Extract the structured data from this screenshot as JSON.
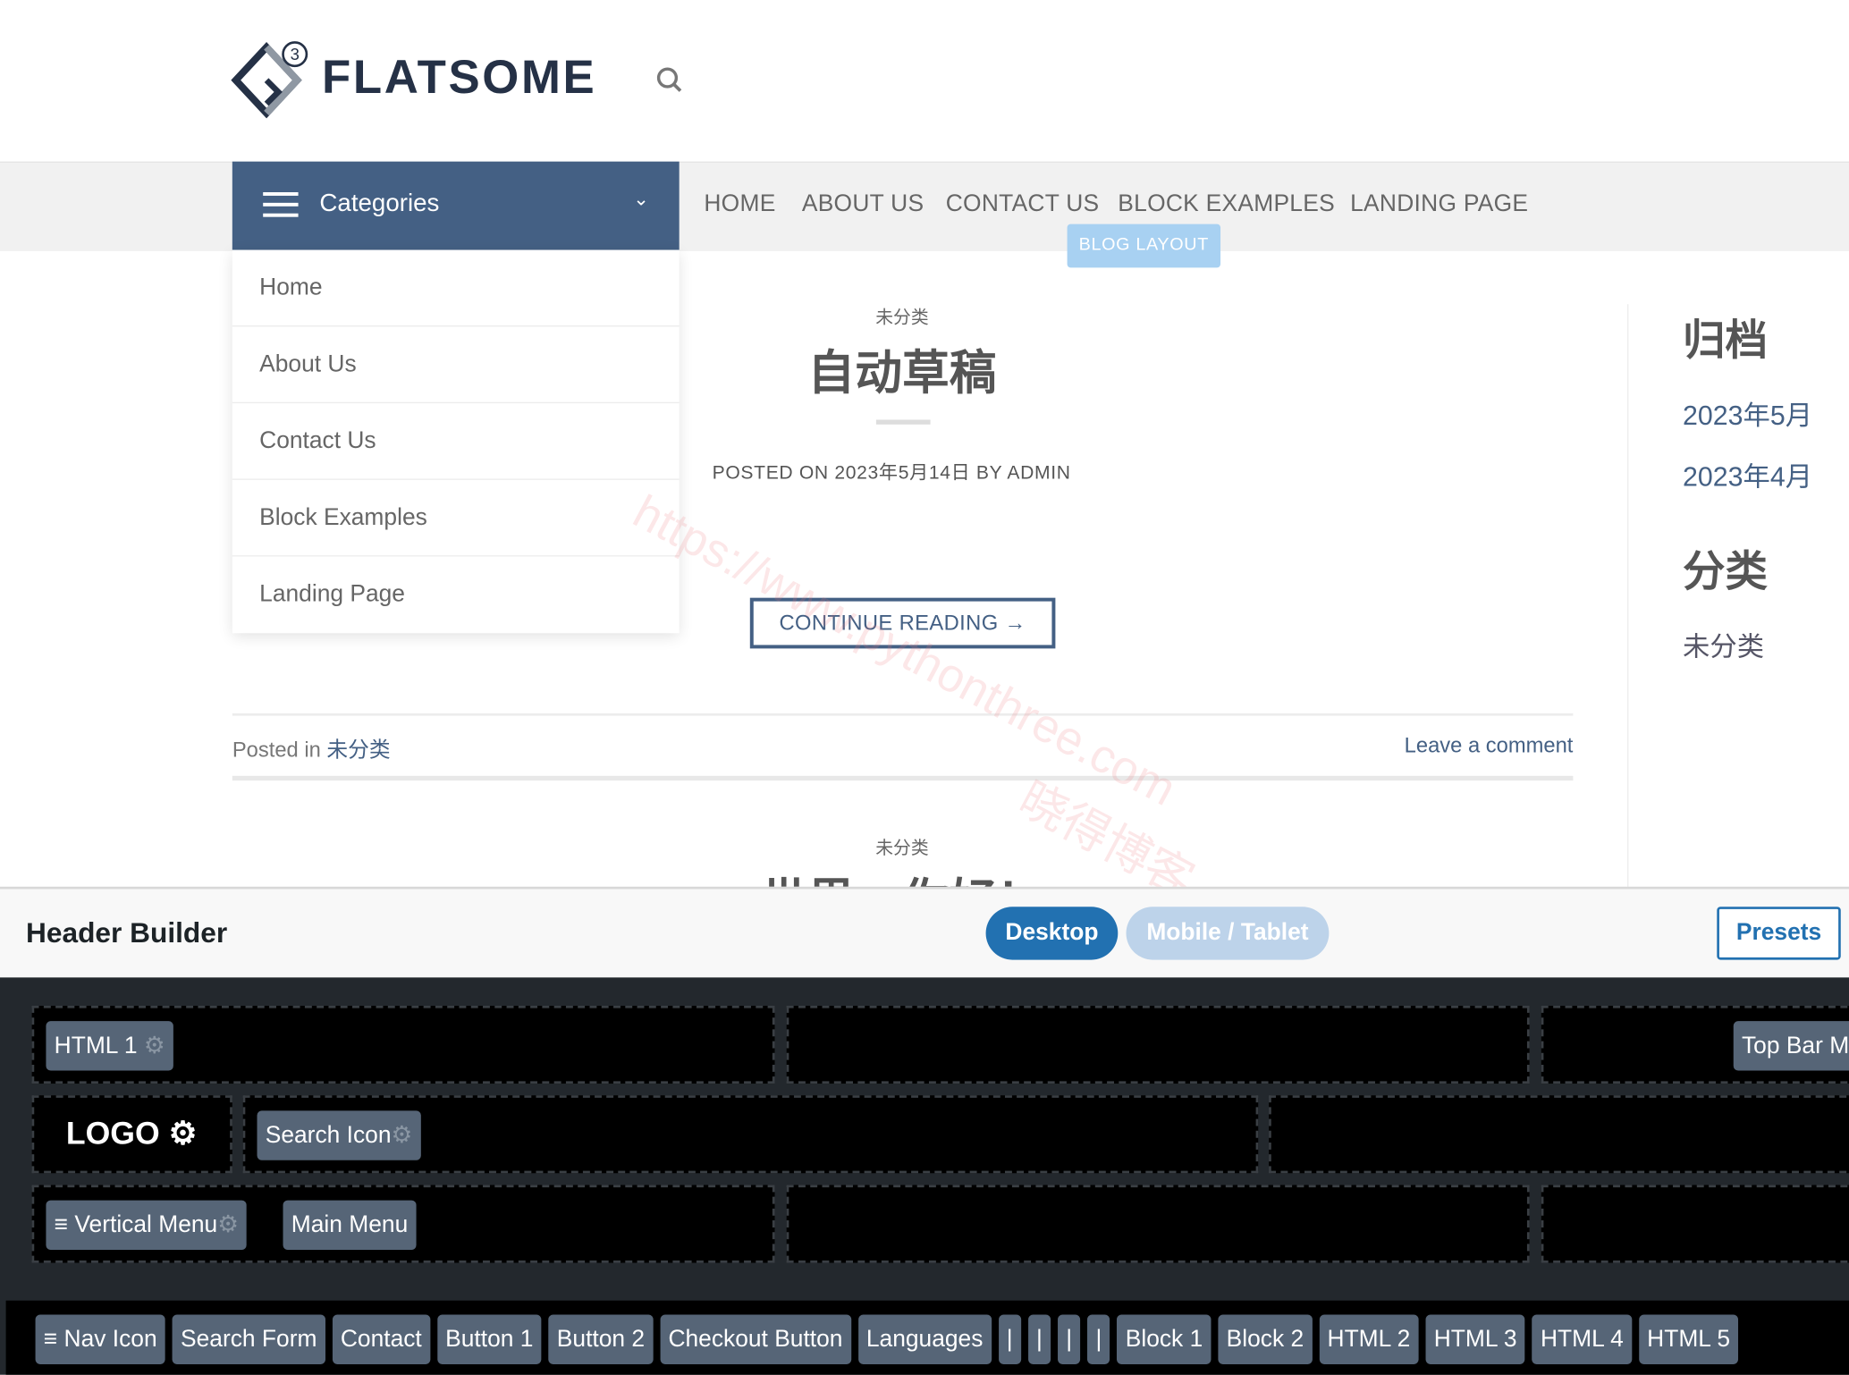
{
  "site": {
    "logo_text": "FLATSOME",
    "logo_badge": "3"
  },
  "categories_menu": {
    "label": "Categories",
    "items": [
      "Home",
      "About Us",
      "Contact Us",
      "Block Examples",
      "Landing Page"
    ]
  },
  "nav": {
    "items": [
      "HOME",
      "ABOUT US",
      "CONTACT US",
      "BLOCK EXAMPLES",
      "LANDING PAGE"
    ],
    "badge": "BLOG LAYOUT"
  },
  "post": {
    "category": "未分类",
    "title": "自动草稿",
    "meta": "POSTED ON 2023年5月14日 BY ADMIN",
    "continue": "CONTINUE READING →",
    "posted_in_prefix": "Posted in",
    "posted_in_cat": "未分类",
    "leave_comment": "Leave a comment"
  },
  "next_post": {
    "category": "未分类",
    "title": "世界，你好！"
  },
  "sidebar": {
    "archives_title": "归档",
    "archives": [
      "2023年5月",
      "2023年4月"
    ],
    "categories_title": "分类",
    "categories": [
      "未分类"
    ]
  },
  "watermark": {
    "url": "https://www.pythonthree.com",
    "name": "晓得博客"
  },
  "header_builder": {
    "title": "Header Builder",
    "desktop": "Desktop",
    "mobile": "Mobile / Tablet",
    "presets": "Presets",
    "top_left": "HTML 1",
    "top_right": "Top Bar M",
    "logo": "LOGO",
    "main_left": "Search Icon",
    "bottom_left": [
      "Vertical Menu",
      "Main Menu"
    ],
    "tray": [
      "Nav Icon",
      "Search Form",
      "Contact",
      "Button 1",
      "Button 2",
      "Checkout Button",
      "Languages",
      "|",
      "|",
      "|",
      "|",
      "Block 1",
      "Block 2",
      "HTML 2",
      "HTML 3",
      "HTML 4",
      "HTML 5"
    ]
  },
  "colors": {
    "primary": "#446084",
    "wp_blue": "#2271b1",
    "chip": "#566577"
  }
}
